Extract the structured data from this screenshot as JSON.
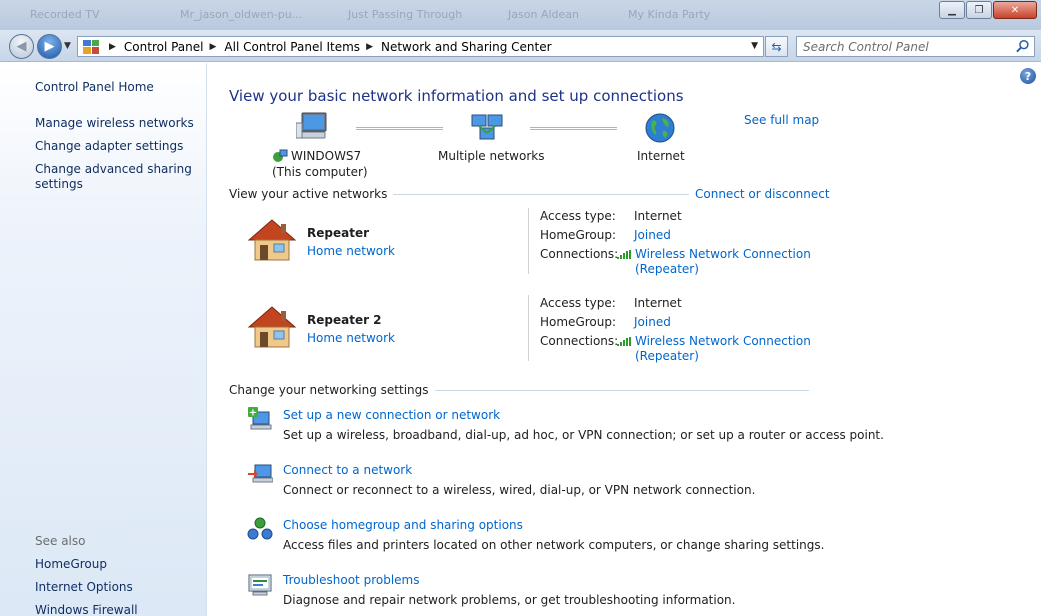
{
  "titlebar": {
    "ghost_tabs": [
      "Recorded TV",
      "Mr_jason_oldwen-pu...",
      "Just Passing Through",
      "Jason Aldean",
      "My Kinda Party"
    ]
  },
  "address": {
    "crumbs": [
      "Control Panel",
      "All Control Panel Items",
      "Network and Sharing Center"
    ],
    "search_placeholder": "Search Control Panel"
  },
  "sidebar": {
    "home": "Control Panel Home",
    "links": [
      "Manage wireless networks",
      "Change adapter settings",
      "Change advanced sharing settings"
    ],
    "see_also": "See also",
    "see_also_links": [
      "HomeGroup",
      "Internet Options",
      "Windows Firewall"
    ]
  },
  "main": {
    "title": "View your basic network information and set up connections",
    "see_full_map": "See full map",
    "map": {
      "computer_name": "WINDOWS7",
      "computer_sub": "(This computer)",
      "middle": "Multiple networks",
      "internet": "Internet"
    },
    "active": {
      "header": "View your active networks",
      "connect_link": "Connect or disconnect",
      "networks": [
        {
          "name": "Repeater",
          "type": "Home network",
          "access_label": "Access type:",
          "access_value": "Internet",
          "homegroup_label": "HomeGroup:",
          "homegroup_value": "Joined",
          "connections_label": "Connections:",
          "connection_line1": "Wireless Network Connection",
          "connection_line2": "(Repeater)"
        },
        {
          "name": "Repeater  2",
          "type": "Home network",
          "access_label": "Access type:",
          "access_value": "Internet",
          "homegroup_label": "HomeGroup:",
          "homegroup_value": "Joined",
          "connections_label": "Connections:",
          "connection_line1": "Wireless Network Connection",
          "connection_line2": "(Repeater)"
        }
      ]
    },
    "change": {
      "header": "Change your networking settings",
      "tasks": [
        {
          "title": "Set up a new connection or network",
          "desc": "Set up a wireless, broadband, dial-up, ad hoc, or VPN connection; or set up a router or access point."
        },
        {
          "title": "Connect to a network",
          "desc": "Connect or reconnect to a wireless, wired, dial-up, or VPN network connection."
        },
        {
          "title": "Choose homegroup and sharing options",
          "desc": "Access files and printers located on other network computers, or change sharing settings."
        },
        {
          "title": "Troubleshoot problems",
          "desc": "Diagnose and repair network problems, or get troubleshooting information."
        }
      ]
    }
  },
  "colors": {
    "link": "#0066cc",
    "title": "#1e3287",
    "sidebar_text": "#0e2d5f"
  }
}
